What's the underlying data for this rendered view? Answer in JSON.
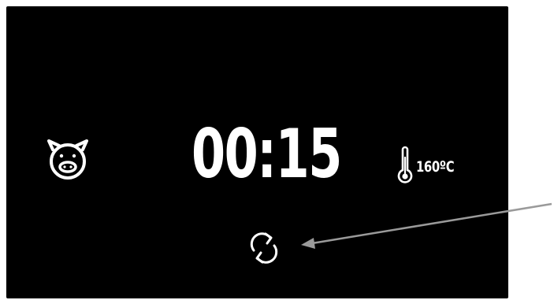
{
  "display": {
    "timer": "00:15",
    "temperature": "160ºC"
  },
  "icons": {
    "left": "pig-face-icon",
    "temperature": "thermometer-icon",
    "action": "refresh-cycle-icon"
  },
  "colors": {
    "screen_background": "#000000",
    "foreground": "#ffffff",
    "callout_arrow": "#9a9a9a"
  }
}
